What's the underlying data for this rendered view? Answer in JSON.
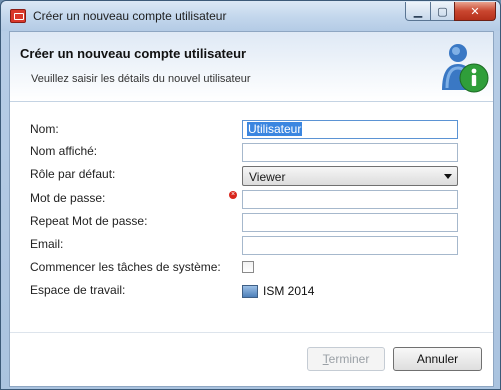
{
  "window": {
    "title": "Créer un nouveau compte utilisateur",
    "app_icon": "app-icon",
    "controls": {
      "minimize": "minimize-icon",
      "maximize": "maximize-icon",
      "close": "close-icon"
    }
  },
  "header": {
    "title": "Créer un nouveau compte utilisateur",
    "subtitle": "Veuillez saisir les détails du nouvel utilisateur",
    "icon": "user-info-icon"
  },
  "form": {
    "name": {
      "label": "Nom:",
      "value": "Utilisateur"
    },
    "display_name": {
      "label": "Nom affiché:",
      "value": ""
    },
    "default_role": {
      "label": "Rôle par défaut:",
      "value": "Viewer"
    },
    "password": {
      "label": "Mot de passe:",
      "value": "",
      "error_icon": "error-icon"
    },
    "repeat_password": {
      "label": "Repeat Mot de passe:",
      "value": ""
    },
    "email": {
      "label": "Email:",
      "value": ""
    },
    "start_system_tasks": {
      "label": "Commencer les tâches de système:",
      "checked": false
    },
    "workspace": {
      "label": "Espace de travail:",
      "value": "ISM 2014",
      "icon": "workspace-icon"
    }
  },
  "buttons": {
    "finish": {
      "label_underlined": "T",
      "label_rest": "erminer",
      "enabled": false
    },
    "cancel": {
      "label": "Annuler"
    }
  },
  "colors": {
    "selection": "#3b86e0",
    "error": "#d9261c",
    "close_button": "#c9462f"
  }
}
